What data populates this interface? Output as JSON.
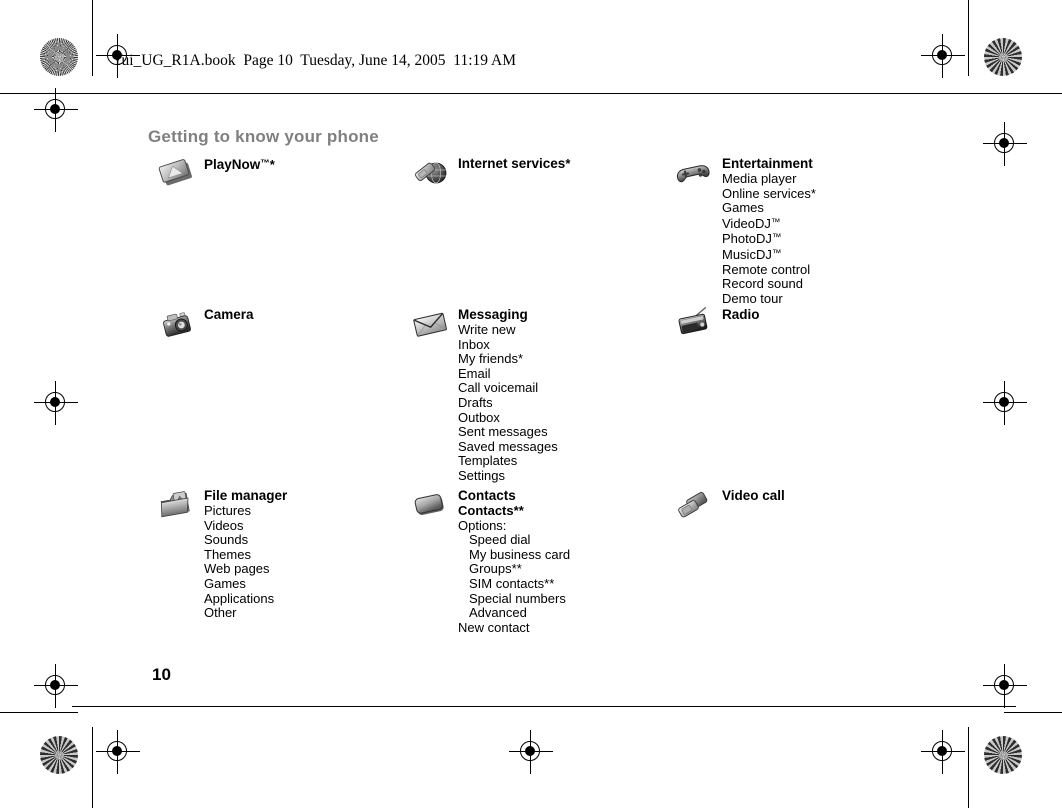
{
  "document": {
    "header_line": "Yui_UG_R1A.book  Page 10  Tuesday, June 14, 2005  11:19 AM",
    "section_title": "Getting to know your phone",
    "page_number": "10"
  },
  "menu": {
    "columns": [
      {
        "name": "left-column",
        "entries": [
          {
            "id": "playnow",
            "icon": "playnow-icon",
            "title": "PlayNow™*",
            "items": []
          },
          {
            "id": "camera",
            "icon": "camera-icon",
            "title": "Camera",
            "items": []
          },
          {
            "id": "file-manager",
            "icon": "folder-icon",
            "title": "File manager",
            "items": [
              "Pictures",
              "Videos",
              "Sounds",
              "Themes",
              "Web pages",
              "Games",
              "Applications",
              "Other"
            ]
          }
        ]
      },
      {
        "name": "middle-column",
        "entries": [
          {
            "id": "internet-services",
            "icon": "internet-services-icon",
            "title": "Internet services*",
            "items": []
          },
          {
            "id": "messaging",
            "icon": "envelope-icon",
            "title": "Messaging",
            "items": [
              "Write new",
              "Inbox",
              "My friends*",
              "Email",
              "Call voicemail",
              "Drafts",
              "Outbox",
              "Sent messages",
              "Saved messages",
              "Templates",
              "Settings"
            ]
          },
          {
            "id": "contacts",
            "icon": "contacts-icon",
            "title": "Contacts",
            "items": [
              "Contacts**",
              "Options:",
              "Speed dial",
              "My business card",
              "Groups**",
              "SIM contacts**",
              "Special numbers",
              "Advanced",
              "New contact"
            ]
          }
        ]
      },
      {
        "name": "right-column",
        "entries": [
          {
            "id": "entertainment",
            "icon": "gamepad-icon",
            "title": "Entertainment",
            "items": [
              "Media player",
              "Online services*",
              "Games",
              "VideoDJ™",
              "PhotoDJ™",
              "MusicDJ™",
              "Remote control",
              "Record sound",
              "Demo tour"
            ]
          },
          {
            "id": "radio",
            "icon": "radio-icon",
            "title": "Radio",
            "items": []
          },
          {
            "id": "video-call",
            "icon": "video-call-icon",
            "title": "Video call",
            "items": []
          }
        ]
      }
    ]
  },
  "colors": {
    "section_title": "#808080",
    "text": "#000000",
    "page_background": "#ffffff"
  }
}
